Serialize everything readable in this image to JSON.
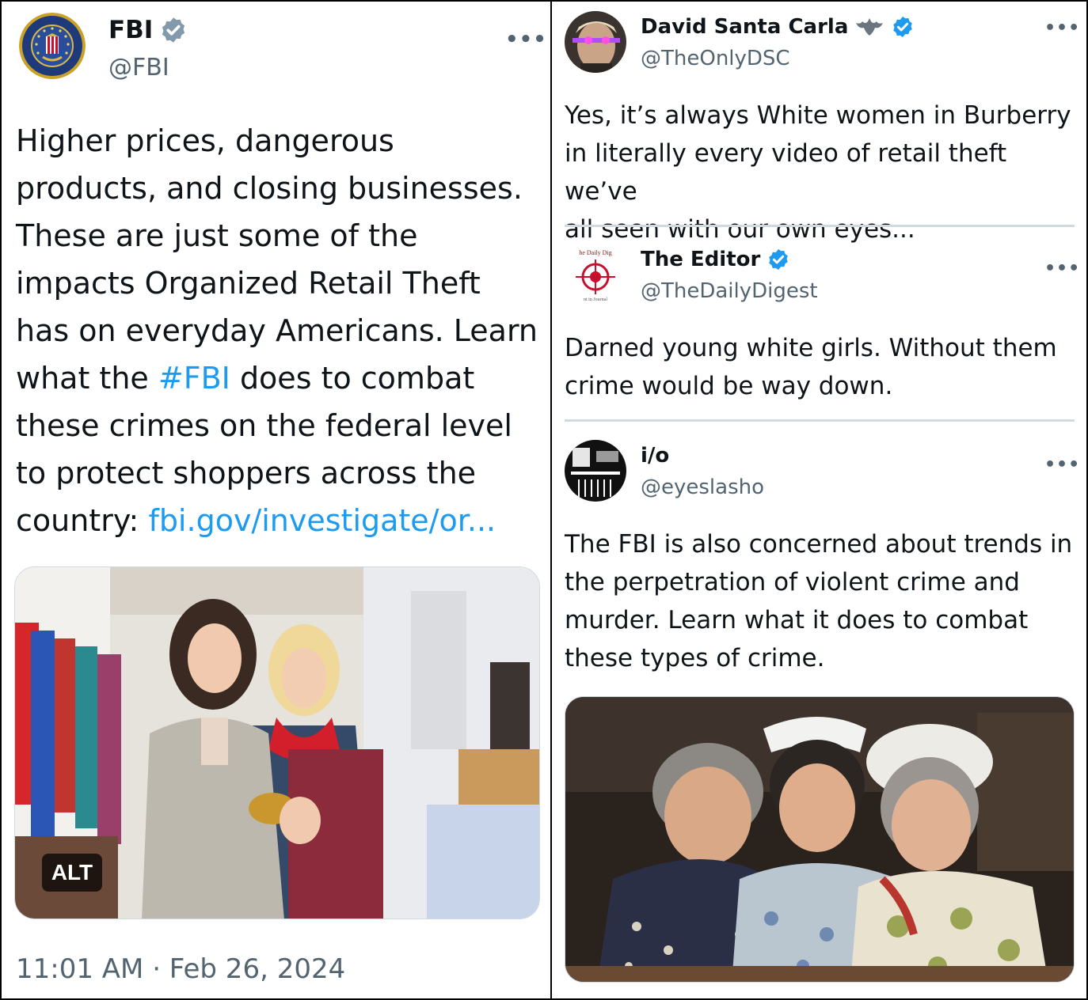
{
  "main_post": {
    "author_name": "FBI",
    "author_handle": "@FBI",
    "text_before_hashtag": "Higher prices, dangerous\nproducts, and closing businesses.\nThese are just some of the\nimpacts Organized Retail Theft\nhas on everyday Americans. Learn\nwhat the ",
    "hashtag": "#FBI",
    "text_after_hashtag": " does to combat\nthese crimes on the federal level\nto protect shoppers across the\ncountry: ",
    "link": "fbi.gov/investigate/or...",
    "alt_label": "ALT",
    "timestamp": "11:01 AM · Feb 26, 2024",
    "more_icon": "more-dots-icon",
    "verified_icon": "verified-badge-icon"
  },
  "replies": [
    {
      "author_name": "David Santa Carla",
      "author_emoji": "bat-icon",
      "author_handle": "@TheOnlyDSC",
      "text": "Yes, it’s always White women in Burberry\nin literally every video of retail theft we’ve\nall seen with our own eyes..."
    },
    {
      "author_name": "The Editor",
      "author_handle": "@TheDailyDigest",
      "text": "Darned young white girls.  Without them\ncrime would be way down."
    },
    {
      "author_name": "i/o",
      "author_handle": "@eyeslasho",
      "text": "The FBI is also concerned about trends in\nthe perpetration of violent crime and\nmurder. Learn what it does to combat\nthese types of crime."
    }
  ],
  "colors": {
    "link": "#1d9bf0",
    "secondary_text": "#536471",
    "verified_gray": "#829aab",
    "verified_blue": "#1d9bf0",
    "separator": "#cfd9de"
  }
}
